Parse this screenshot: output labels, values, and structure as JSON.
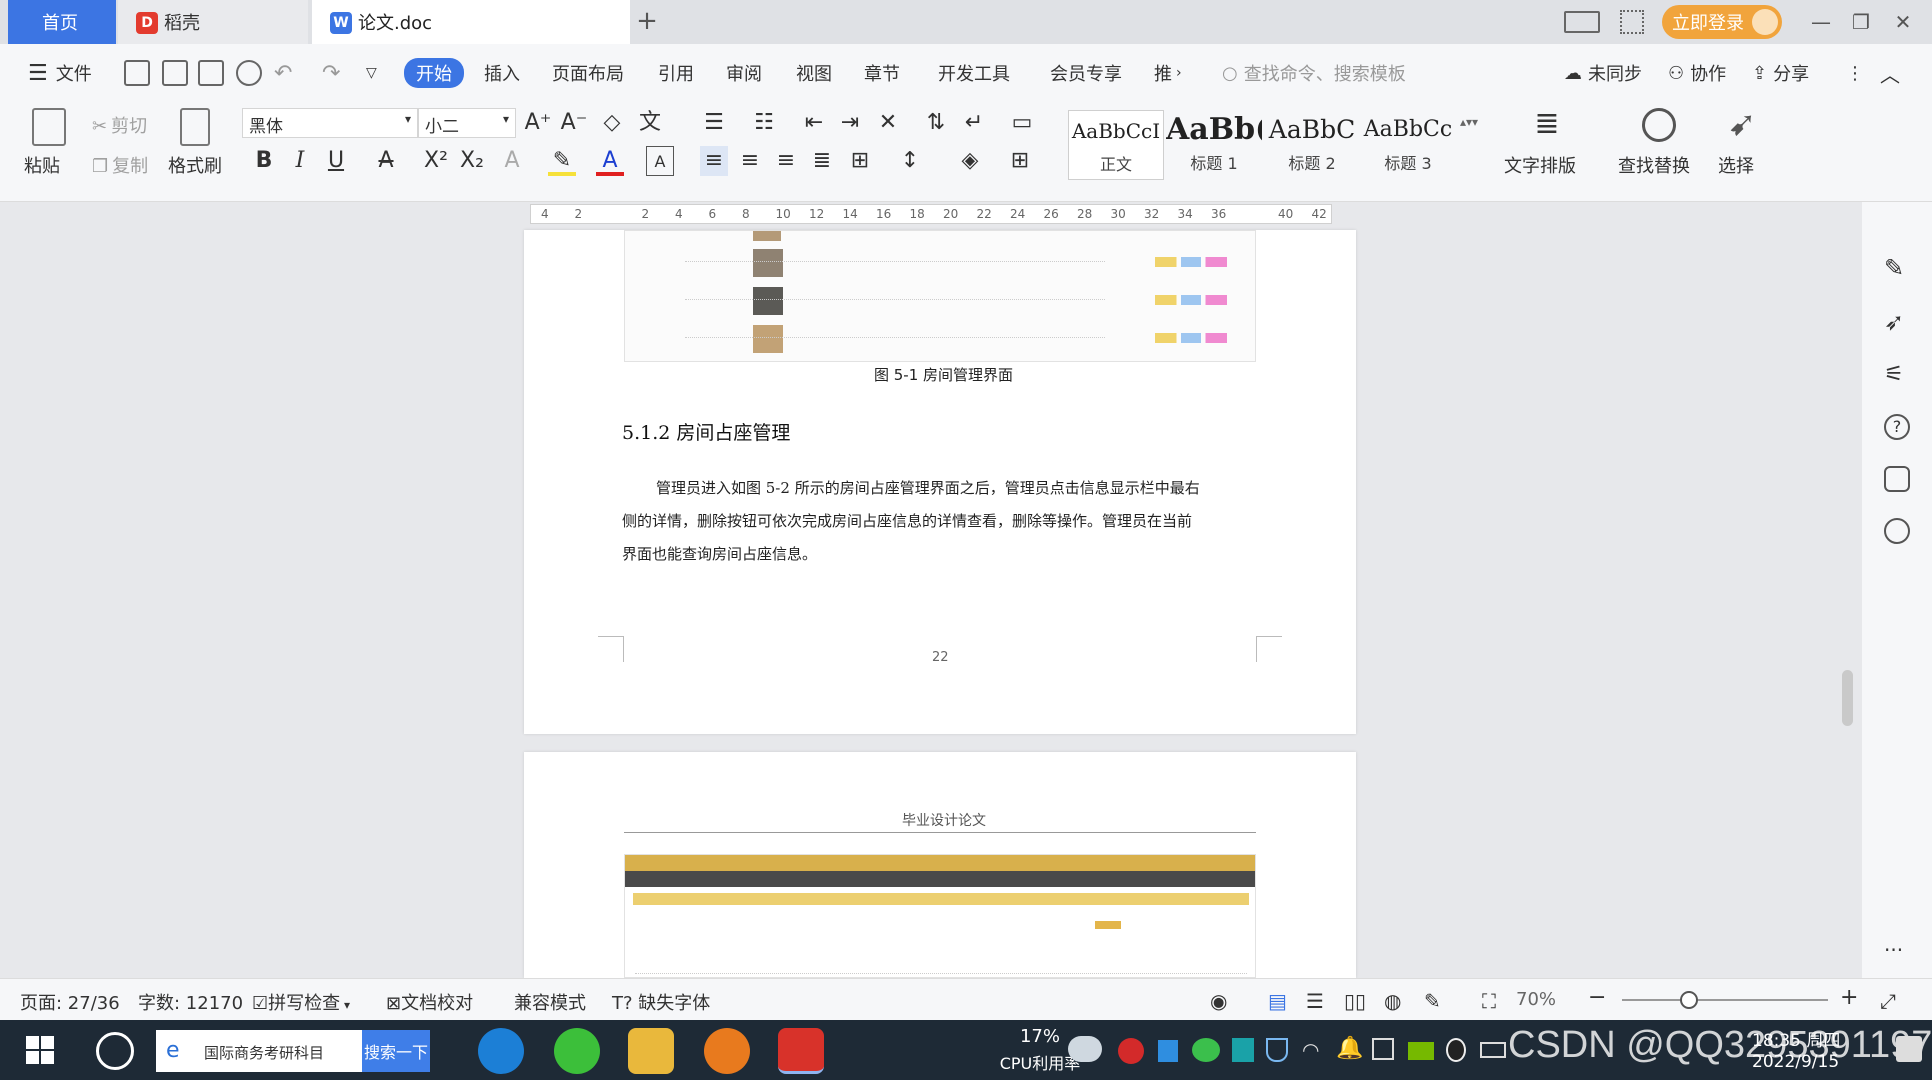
{
  "tabs": [
    {
      "label": "首页",
      "active": false
    },
    {
      "label": "稻壳",
      "active": false
    },
    {
      "label": "论文.doc",
      "active": true
    }
  ],
  "titlebar": {
    "login_label": "立即登录"
  },
  "menu": {
    "file_label": "文件",
    "items": [
      "开始",
      "插入",
      "页面布局",
      "引用",
      "审阅",
      "视图",
      "章节",
      "开发工具",
      "会员专享",
      "推"
    ],
    "search_placeholder": "查找命令、搜索模板",
    "sync_label": "未同步",
    "collab_label": "协作",
    "share_label": "分享"
  },
  "ribbon": {
    "paste_label": "粘贴",
    "cut_label": "剪切",
    "copy_label": "复制",
    "format_painter_label": "格式刷",
    "font_name": "黑体",
    "font_size": "小二",
    "styles": [
      {
        "preview": "AaBbCcI",
        "label": "正文"
      },
      {
        "preview": "AaBb(",
        "label": "标题 1"
      },
      {
        "preview": "AaBbC",
        "label": "标题 2"
      },
      {
        "preview": "AaBbCc",
        "label": "标题 3"
      }
    ],
    "text_layout_label": "文字排版",
    "find_replace_label": "查找替换",
    "select_label": "选择"
  },
  "ruler": {
    "ticks": [
      "4",
      "2",
      "",
      "2",
      "4",
      "6",
      "8",
      "10",
      "12",
      "14",
      "16",
      "18",
      "20",
      "22",
      "24",
      "26",
      "28",
      "30",
      "32",
      "34",
      "36",
      "",
      "40",
      "42"
    ]
  },
  "document": {
    "figure_caption": "图 5-1  房间管理界面",
    "section_heading": "5.1.2  房间占座管理",
    "paragraph_lines": [
      "管理员进入如图 5-2 所示的房间占座管理界面之后，管理员点击信息显示栏中最右",
      "侧的详情，删除按钮可依次完成房间占座信息的详情查看，删除等操作。管理员在当前",
      "界面也能查询房间占座信息。"
    ],
    "page_number": "22",
    "next_page_header": "毕业设计论文"
  },
  "statusbar": {
    "page": "页面: 27/36",
    "word_count": "字数: 12170",
    "spell_check": "拼写检查",
    "doc_proofread": "文档校对",
    "compat_mode": "兼容模式",
    "missing_fonts": "缺失字体",
    "zoom": "70%"
  },
  "taskbar": {
    "search_text": "国际商务考研科目",
    "search_button": "搜索一下",
    "cpu_percent": "17%",
    "cpu_label": "CPU利用率",
    "watermark": "CSDN @QQ3295391197",
    "time": "18:35 周四",
    "date": "2022/9/15"
  },
  "colors": {
    "accent": "#3c75e3",
    "login": "#f1a43c",
    "taskbar": "#1e2a36"
  }
}
